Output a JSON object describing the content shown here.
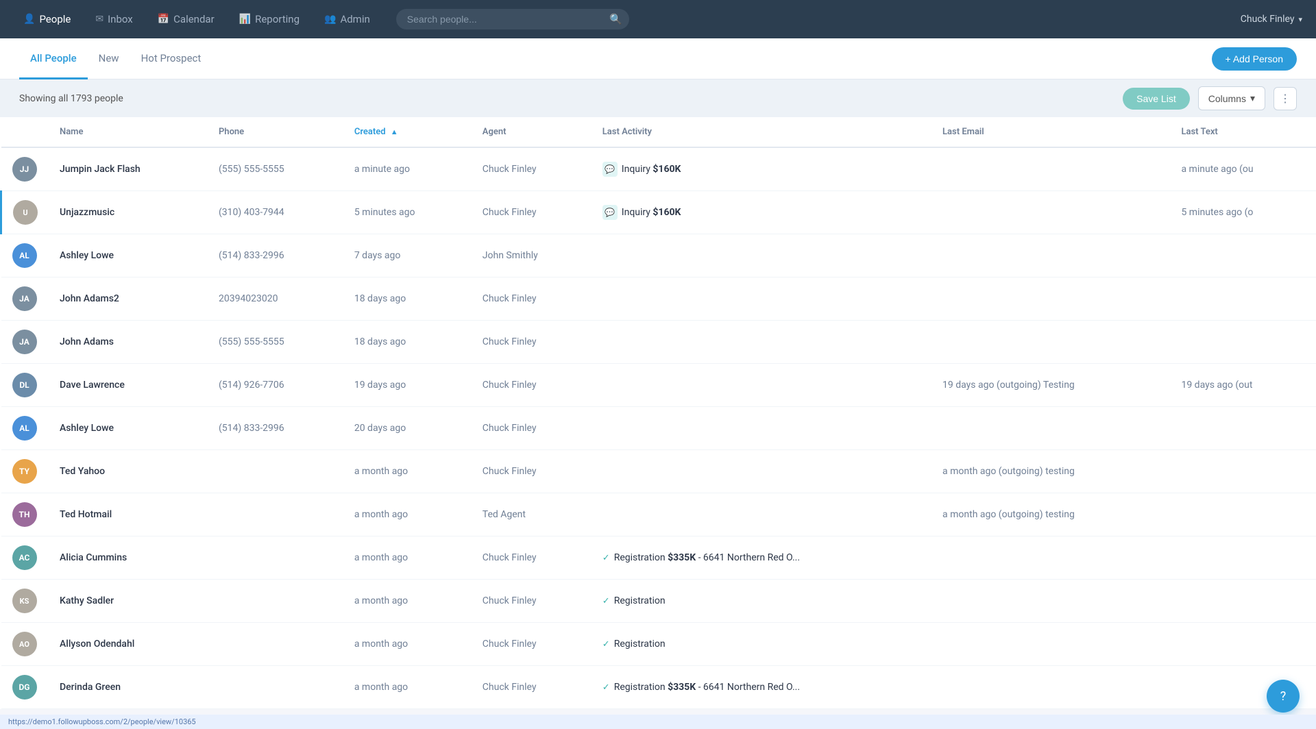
{
  "nav": {
    "items": [
      {
        "id": "people",
        "label": "People",
        "icon": "👤",
        "active": true
      },
      {
        "id": "inbox",
        "label": "Inbox",
        "icon": "✉",
        "active": false
      },
      {
        "id": "calendar",
        "label": "Calendar",
        "icon": "📅",
        "active": false
      },
      {
        "id": "reporting",
        "label": "Reporting",
        "icon": "📊",
        "active": false
      },
      {
        "id": "admin",
        "label": "Admin",
        "icon": "👥",
        "active": false
      }
    ],
    "search_placeholder": "Search people...",
    "user_name": "Chuck Finley"
  },
  "tabs": [
    {
      "id": "all",
      "label": "All People",
      "active": true
    },
    {
      "id": "new",
      "label": "New",
      "active": false
    },
    {
      "id": "hot",
      "label": "Hot Prospect",
      "active": false
    }
  ],
  "toolbar": {
    "showing_text": "Showing all 1793 people",
    "save_list_label": "Save List",
    "columns_label": "Columns",
    "add_person_label": "+ Add Person"
  },
  "table": {
    "columns": [
      {
        "id": "avatar",
        "label": ""
      },
      {
        "id": "name",
        "label": "Name"
      },
      {
        "id": "phone",
        "label": "Phone"
      },
      {
        "id": "created",
        "label": "Created",
        "sortable": true,
        "sort_dir": "asc"
      },
      {
        "id": "agent",
        "label": "Agent"
      },
      {
        "id": "last_activity",
        "label": "Last Activity"
      },
      {
        "id": "last_email",
        "label": "Last Email"
      },
      {
        "id": "last_text",
        "label": "Last Text"
      }
    ],
    "rows": [
      {
        "id": 1,
        "initials": "JJ",
        "avatar_color": "#7b8fa0",
        "avatar_img": null,
        "name": "Jumpin Jack Flash",
        "phone": "(555) 555-5555",
        "created": "a minute ago",
        "agent": "Chuck Finley",
        "last_activity_icon": "chat",
        "last_activity_text": "Inquiry ",
        "last_activity_amount": "$160K",
        "last_email": "",
        "last_text": "a minute ago (ou",
        "active": false
      },
      {
        "id": 2,
        "initials": "U",
        "avatar_color": "#c5765a",
        "avatar_img": "portrait_female",
        "name": "Unjazzmusic",
        "phone": "(310) 403-7944",
        "created": "5 minutes ago",
        "agent": "Chuck Finley",
        "last_activity_icon": "chat",
        "last_activity_text": "Inquiry ",
        "last_activity_amount": "$160K",
        "last_email": "",
        "last_text": "5 minutes ago (o",
        "active": true
      },
      {
        "id": 3,
        "initials": "AL",
        "avatar_color": "#4a90d9",
        "avatar_img": null,
        "name": "Ashley Lowe",
        "phone": "(514) 833-2996",
        "created": "7 days ago",
        "agent": "John Smithly",
        "last_activity_icon": null,
        "last_activity_text": "",
        "last_activity_amount": "",
        "last_email": "",
        "last_text": "",
        "active": false
      },
      {
        "id": 4,
        "initials": "JA",
        "avatar_color": "#7b8fa0",
        "avatar_img": null,
        "name": "John Adams2",
        "phone": "20394023020",
        "created": "18 days ago",
        "agent": "Chuck Finley",
        "last_activity_icon": null,
        "last_activity_text": "",
        "last_activity_amount": "",
        "last_email": "",
        "last_text": "",
        "active": false
      },
      {
        "id": 5,
        "initials": "JA",
        "avatar_color": "#7b8fa0",
        "avatar_img": null,
        "name": "John Adams",
        "phone": "(555) 555-5555",
        "created": "18 days ago",
        "agent": "Chuck Finley",
        "last_activity_icon": null,
        "last_activity_text": "",
        "last_activity_amount": "",
        "last_email": "",
        "last_text": "",
        "active": false
      },
      {
        "id": 6,
        "initials": "DL",
        "avatar_color": "#6b8caa",
        "avatar_img": null,
        "name": "Dave Lawrence",
        "phone": "(514) 926-7706",
        "created": "19 days ago",
        "agent": "Chuck Finley",
        "last_activity_icon": null,
        "last_activity_text": "",
        "last_activity_amount": "",
        "last_email": "19 days ago (outgoing) Testing",
        "last_text": "19 days ago (out",
        "active": false
      },
      {
        "id": 7,
        "initials": "AL",
        "avatar_color": "#4a90d9",
        "avatar_img": null,
        "name": "Ashley Lowe",
        "phone": "(514) 833-2996",
        "created": "20 days ago",
        "agent": "Chuck Finley",
        "last_activity_icon": null,
        "last_activity_text": "",
        "last_activity_amount": "",
        "last_email": "",
        "last_text": "",
        "active": false
      },
      {
        "id": 8,
        "initials": "TY",
        "avatar_color": "#e8a44a",
        "avatar_img": null,
        "name": "Ted Yahoo",
        "phone": "",
        "created": "a month ago",
        "agent": "Chuck Finley",
        "last_activity_icon": null,
        "last_activity_text": "",
        "last_activity_amount": "",
        "last_email": "a month ago (outgoing) testing",
        "last_text": "",
        "active": false
      },
      {
        "id": 9,
        "initials": "TH",
        "avatar_color": "#9b6b9b",
        "avatar_img": null,
        "name": "Ted Hotmail",
        "phone": "",
        "created": "a month ago",
        "agent": "Ted Agent",
        "last_activity_icon": null,
        "last_activity_text": "",
        "last_activity_amount": "",
        "last_email": "a month ago (outgoing) testing",
        "last_text": "",
        "active": false
      },
      {
        "id": 10,
        "initials": "AC",
        "avatar_color": "#5ba5a5",
        "avatar_img": null,
        "name": "Alicia Cummins",
        "phone": "",
        "created": "a month ago",
        "agent": "Chuck Finley",
        "last_activity_icon": "check",
        "last_activity_text": "Registration ",
        "last_activity_amount": "$335K",
        "last_activity_extra": " - 6641 Northern Red O...",
        "last_email": "",
        "last_text": "",
        "active": false
      },
      {
        "id": 11,
        "initials": "KS",
        "avatar_color": null,
        "avatar_img": "portrait_female2",
        "name": "Kathy Sadler",
        "phone": "",
        "created": "a month ago",
        "agent": "Chuck Finley",
        "last_activity_icon": "check",
        "last_activity_text": "Registration",
        "last_activity_amount": "",
        "last_email": "",
        "last_text": "",
        "active": false
      },
      {
        "id": 12,
        "initials": "AO",
        "avatar_color": null,
        "avatar_img": "portrait_female3",
        "name": "Allyson Odendahl",
        "phone": "",
        "created": "a month ago",
        "agent": "Chuck Finley",
        "last_activity_icon": "check",
        "last_activity_text": "Registration",
        "last_activity_amount": "",
        "last_email": "",
        "last_text": "",
        "active": false
      },
      {
        "id": 13,
        "initials": "DG",
        "avatar_color": "#5ba5a5",
        "avatar_img": null,
        "name": "Derinda Green",
        "phone": "",
        "created": "a month ago",
        "agent": "Chuck Finley",
        "last_activity_icon": "check",
        "last_activity_text": "Registration ",
        "last_activity_amount": "$335K",
        "last_activity_extra": " - 6641 Northern Red O...",
        "last_email": "",
        "last_text": "",
        "active": false
      }
    ]
  },
  "status_bar": {
    "url": "https://demo1.followupboss.com/2/people/view/10365"
  },
  "help_btn_label": "?"
}
